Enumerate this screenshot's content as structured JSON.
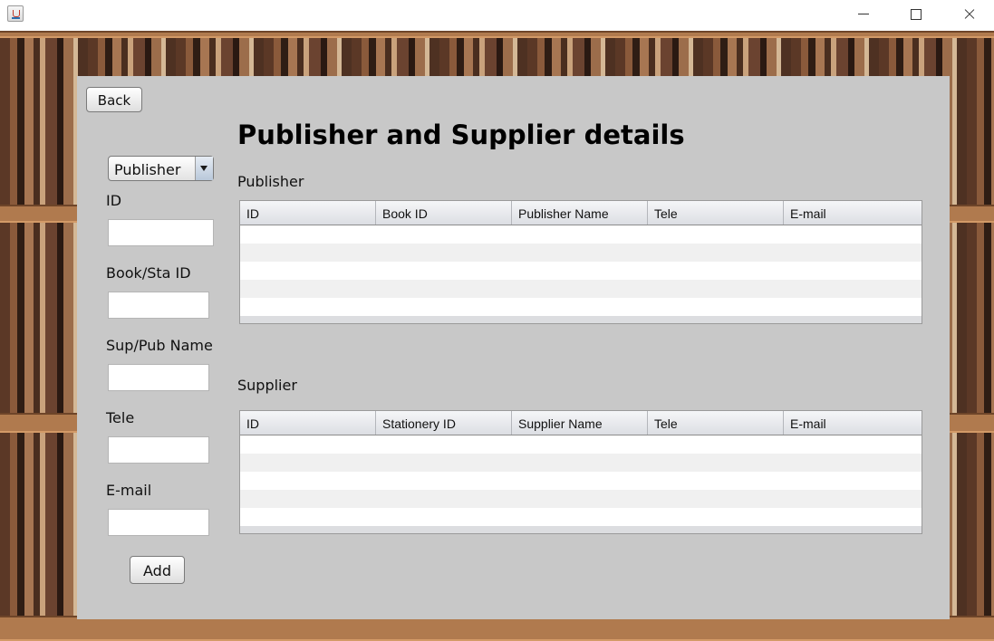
{
  "window": {
    "title": ""
  },
  "toolbar": {
    "back_label": "Back"
  },
  "header": {
    "title": "Publisher and Supplier details"
  },
  "form": {
    "type_select": {
      "value": "Publisher"
    },
    "id_label": "ID",
    "book_sta_id_label": "Book/Sta ID",
    "sup_pub_name_label": "Sup/Pub Name",
    "tele_label": "Tele",
    "email_label": "E-mail",
    "add_label": "Add"
  },
  "publisher": {
    "label": "Publisher",
    "columns": [
      "ID",
      "Book ID",
      "Publisher Name",
      "Tele",
      "E-mail"
    ],
    "rows": []
  },
  "supplier": {
    "label": "Supplier",
    "columns": [
      "ID",
      "Stationery ID",
      "Supplier Name",
      "Tele",
      "E-mail"
    ],
    "rows": []
  }
}
